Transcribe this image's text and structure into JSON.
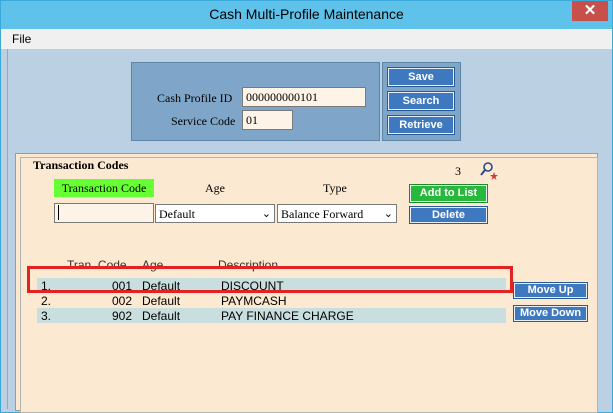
{
  "window": {
    "title": "Cash Multi-Profile Maintenance",
    "close_glyph": "✕"
  },
  "menu": {
    "file": "File"
  },
  "criteria": {
    "profile_id_label": "Cash Profile ID",
    "profile_id_value": "000000000101",
    "service_code_label": "Service Code",
    "service_code_value": "01"
  },
  "actions": {
    "save": "Save",
    "search": "Search",
    "retrieve": "Retrieve"
  },
  "transaction_codes": {
    "title": "Transaction Codes",
    "count": "3",
    "code_label": "Transaction Code",
    "age_label": "Age",
    "type_label": "Type",
    "code_value": "",
    "age_selected": "Default",
    "type_selected": "Balance Forward",
    "add_to_list": "Add to List",
    "delete": "Delete"
  },
  "list": {
    "headers": {
      "tran_code": "Tran. Code",
      "age": "Age",
      "description": "Description"
    },
    "rows": [
      {
        "index": "1.",
        "code": "001",
        "age": "Default",
        "description": "DISCOUNT"
      },
      {
        "index": "2.",
        "code": "002",
        "age": "Default",
        "description": "PAYMCASH"
      },
      {
        "index": "3.",
        "code": "902",
        "age": "Default",
        "description": "PAY FINANCE CHARGE"
      }
    ],
    "row_colors": [
      "#c9dfdf",
      "#fce9d2",
      "#c9dfdf"
    ],
    "move_up": "Move Up",
    "move_down": "Move Down"
  },
  "icons": {
    "find": "magnifier-icon",
    "close": "close-icon",
    "dropdown": "chevron-down-icon"
  },
  "colors": {
    "titlebar": "#5fc2ea",
    "panel": "#7fa6c8",
    "button_blue": "#3e78bf",
    "button_green": "#28b83c",
    "label_green": "#66ff33",
    "highlight": "#e32222"
  }
}
